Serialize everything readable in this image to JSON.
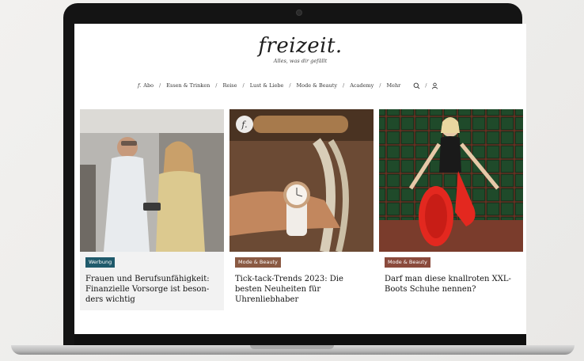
{
  "brand": {
    "logo": "freizeit.",
    "tagline": "Alles, was dir gefällt"
  },
  "nav": {
    "abo_mark": "f.",
    "items": [
      "Abo",
      "Essen & Trinken",
      "Reise",
      "Lust & Liebe",
      "Mode & Beauty",
      "Academy",
      "Mehr"
    ],
    "separator": "/",
    "icons": [
      "search-icon",
      "user-icon"
    ]
  },
  "cards": [
    {
      "badge": "Werbung",
      "badge_color": "#1f5a6b",
      "title": "Frauen und Berufsunfähigkeit: Finanzielle Vorsorge ist beson-ders wichtig",
      "image": "two-people-looking-at-phone"
    },
    {
      "badge": "Mode & Beauty",
      "badge_color": "#8a5a43",
      "title": "Tick-tack-Trends 2023: Die besten Neuheiten für Uhrenliebhaber",
      "image": "wristwatch-on-rope",
      "mark": "f."
    },
    {
      "badge": "Mode & Beauty",
      "badge_color": "#8a4a3c",
      "title": "Darf man diese knallroten XXL-Boots Schuhe nennen?",
      "image": "woman-with-red-boots-on-plaid-sofa"
    }
  ],
  "colors": {
    "lid": "#141414",
    "screen_bg": "#ffffff",
    "card_bg": "#f2f2f2"
  }
}
